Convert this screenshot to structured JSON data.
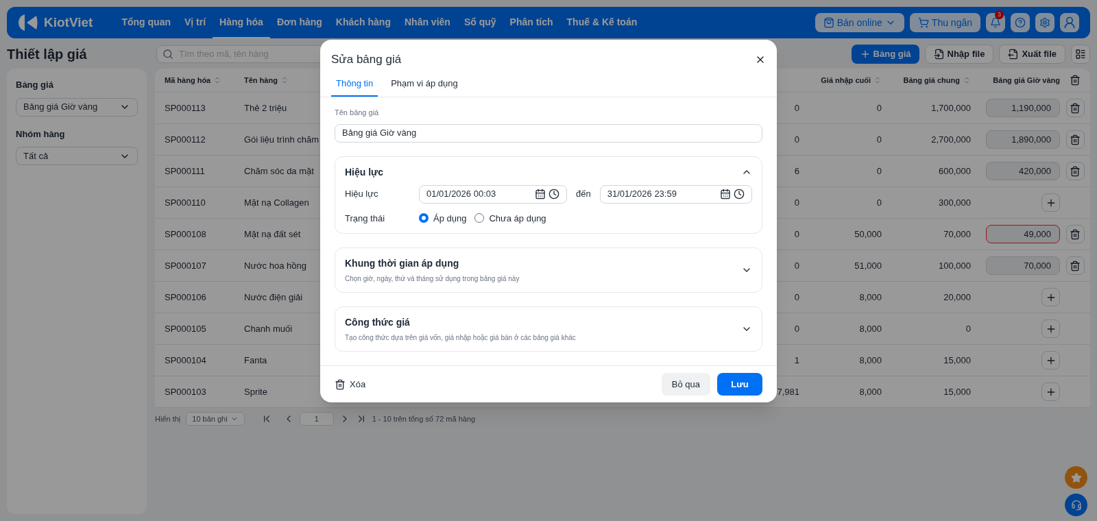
{
  "topbar": {
    "brand": "KiotViet",
    "nav": [
      {
        "label": "Tổng quan",
        "selected": false
      },
      {
        "label": "Vị trí",
        "selected": false
      },
      {
        "label": "Hàng hóa",
        "selected": true
      },
      {
        "label": "Đơn hàng",
        "selected": false
      },
      {
        "label": "Khách hàng",
        "selected": false
      },
      {
        "label": "Nhân viên",
        "selected": false
      },
      {
        "label": "Sổ quỹ",
        "selected": false
      },
      {
        "label": "Phân tích",
        "selected": false
      },
      {
        "label": "Thuế & Kế toán",
        "selected": false
      }
    ],
    "online_button": "Bán online",
    "cashier_button": "Thu ngân",
    "notification_count": "3"
  },
  "page": {
    "title": "Thiết lập giá",
    "search": {
      "placeholder": "Tìm theo mã, tên hàng"
    },
    "add_button": "Bảng giá",
    "import_button": "Nhập file",
    "export_button": "Xuất file"
  },
  "sidebar": {
    "filters": [
      {
        "label": "Bảng giá",
        "value": "Bảng giá Giờ vàng"
      },
      {
        "label": "Nhóm hàng",
        "value": "Tất cả"
      }
    ]
  },
  "table": {
    "columns": [
      "Mã hàng hóa",
      "Tên hàng",
      "",
      "Giá nhập cuối",
      "Bảng giá chung",
      "Bảng giá Giờ vàng"
    ],
    "rows": [
      {
        "code": "SP000113",
        "name": "Thẻ 2 triệu",
        "column_3": "0",
        "last_import": "0",
        "general": "1,700,000",
        "golden": {
          "kind": "input",
          "value": "1,190,000",
          "invalid": false
        }
      },
      {
        "code": "SP000112",
        "name": "Gói liệu trình chăm",
        "column_3": "0",
        "last_import": "0",
        "general": "2,700,000",
        "golden": {
          "kind": "input",
          "value": "1,890,000",
          "invalid": false
        }
      },
      {
        "code": "SP000111",
        "name": "Chăm sóc da mặt",
        "column_3": "6",
        "last_import": "0",
        "general": "600,000",
        "golden": {
          "kind": "input",
          "value": "420,000",
          "invalid": false
        }
      },
      {
        "code": "SP000110",
        "name": "Mặt nạ Collagen",
        "column_3": "0",
        "last_import": "0",
        "general": "300,000",
        "golden": {
          "kind": "add"
        }
      },
      {
        "code": "SP000108",
        "name": "Mặt nạ đất sét",
        "column_3": "0",
        "last_import": "50,000",
        "general": "70,000",
        "golden": {
          "kind": "input",
          "value": "49,000",
          "invalid": true
        }
      },
      {
        "code": "SP000107",
        "name": "Nước hoa hồng",
        "column_3": "0",
        "last_import": "51,000",
        "general": "100,000",
        "golden": {
          "kind": "input",
          "value": "70,000",
          "invalid": false
        }
      },
      {
        "code": "SP000106",
        "name": "Nước điện giải",
        "column_3": "0",
        "last_import": "8,000",
        "general": "20,000",
        "golden": {
          "kind": "add"
        }
      },
      {
        "code": "SP000105",
        "name": "Chanh muối",
        "column_3": "0",
        "last_import": "8,000",
        "general": "0",
        "golden": {
          "kind": "add"
        }
      },
      {
        "code": "SP000104",
        "name": "Fanta",
        "column_3": "1",
        "last_import": "8,000",
        "general": "15,000",
        "golden": {
          "kind": "add"
        }
      },
      {
        "code": "SP000103",
        "name": "Sprite",
        "column_3": "7,981",
        "last_import": "8,000",
        "general": "15,000",
        "golden": {
          "kind": "add"
        }
      }
    ]
  },
  "pagination": {
    "show_label": "Hiển thị",
    "page_size": "10 bản ghi",
    "page": "1",
    "summary": "1 - 10 trên tổng số 72 mã hàng"
  },
  "dialog": {
    "title": "Sửa bảng giá",
    "tabs": [
      {
        "label": "Thông tin",
        "selected": true
      },
      {
        "label": "Phạm vi áp dụng",
        "selected": false
      }
    ],
    "name_label": "Tên bảng giá",
    "name_value": "Bảng giá Giờ vàng",
    "sections": [
      {
        "title": "Hiệu lực",
        "expanded": true,
        "validity_label": "Hiệu lực",
        "from": "01/01/2026 00:03",
        "to_label": "đến",
        "to": "31/01/2026 23:59",
        "status_label": "Trạng thái",
        "status_options": [
          {
            "label": "Áp dụng",
            "selected": true
          },
          {
            "label": "Chưa áp dụng",
            "selected": false
          }
        ]
      },
      {
        "title": "Khung thời gian áp dụng",
        "expanded": false,
        "description": "Chọn giờ, ngày, thứ và tháng sử dụng trong bảng giá này"
      },
      {
        "title": "Công thức giá",
        "expanded": false,
        "description": "Tạo công thức dựa trên giá vốn, giá nhập hoặc giá bán ở các bảng giá khác"
      }
    ],
    "delete_button": "Xóa",
    "cancel_button": "Bỏ qua",
    "save_button": "Lưu"
  }
}
